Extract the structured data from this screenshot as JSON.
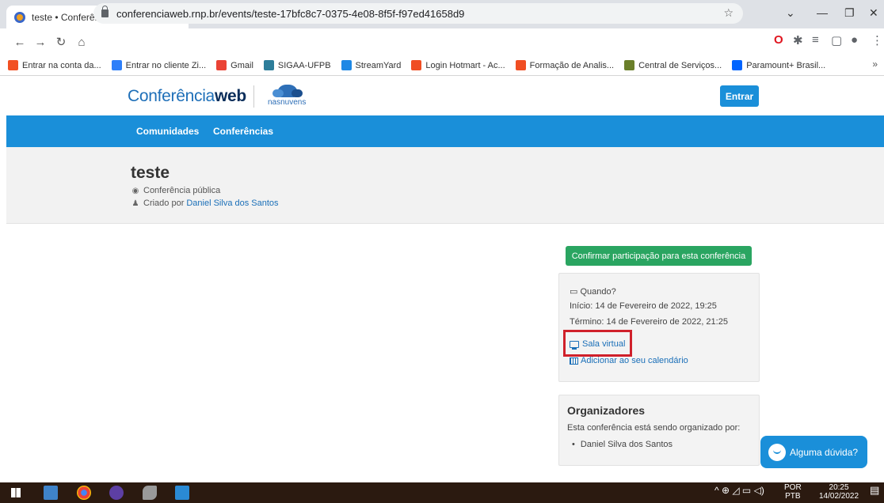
{
  "browser": {
    "tab_title": "teste • Conferência Web",
    "tab_close": "×",
    "new_tab": "+",
    "url": "conferenciaweb.rnp.br/events/teste-17bfc8c7-0375-4e08-8f5f-f97ed41658d9",
    "bookmarks": [
      {
        "label": "Entrar na conta da...",
        "color": "#f25022"
      },
      {
        "label": "Entrar no cliente Zi...",
        "color": "#2d7ff9"
      },
      {
        "label": "Gmail",
        "color": "#ea4335"
      },
      {
        "label": "SIGAA-UFPB",
        "color": "#2d7d9a"
      },
      {
        "label": "StreamYard",
        "color": "#1e88e5"
      },
      {
        "label": "Login Hotmart - Ac...",
        "color": "#f04e23"
      },
      {
        "label": "Formação de Analis...",
        "color": "#f04e23"
      },
      {
        "label": "Central de Serviços...",
        "color": "#6a7f2a"
      },
      {
        "label": "Paramount+ Brasil...",
        "color": "#0064ff"
      }
    ],
    "bookmarks_more": "»"
  },
  "site": {
    "logo_light": "Conferência",
    "logo_bold": "web",
    "partner_logo": "nasnuvens",
    "login_label": "Entrar",
    "nav": [
      "Comunidades",
      "Conferências"
    ]
  },
  "event": {
    "title": "teste",
    "visibility": "Conferência pública",
    "created_by_label": "Criado por",
    "created_by": "Daniel Silva dos Santos",
    "confirm_label": "Confirmar participação para esta conferência",
    "when_label": "Quando?",
    "start": "Início: 14 de Fevereiro de 2022, 19:25",
    "end": "Término: 14 de Fevereiro de 2022, 21:25",
    "virtual_room": "Sala virtual",
    "add_calendar": "Adicionar ao seu calendário"
  },
  "organizers": {
    "title": "Organizadores",
    "description": "Esta conferência está sendo organizado por:",
    "items": [
      "Daniel Silva dos Santos"
    ]
  },
  "help_label": "Alguma dúvida?",
  "taskbar": {
    "lang_top": "POR",
    "lang_bottom": "PTB",
    "time": "20:25",
    "date": "14/02/2022"
  },
  "colors": {
    "brand_blue": "#1a8fd9",
    "confirm_green": "#2aa561",
    "highlight_red": "#d0202a"
  }
}
